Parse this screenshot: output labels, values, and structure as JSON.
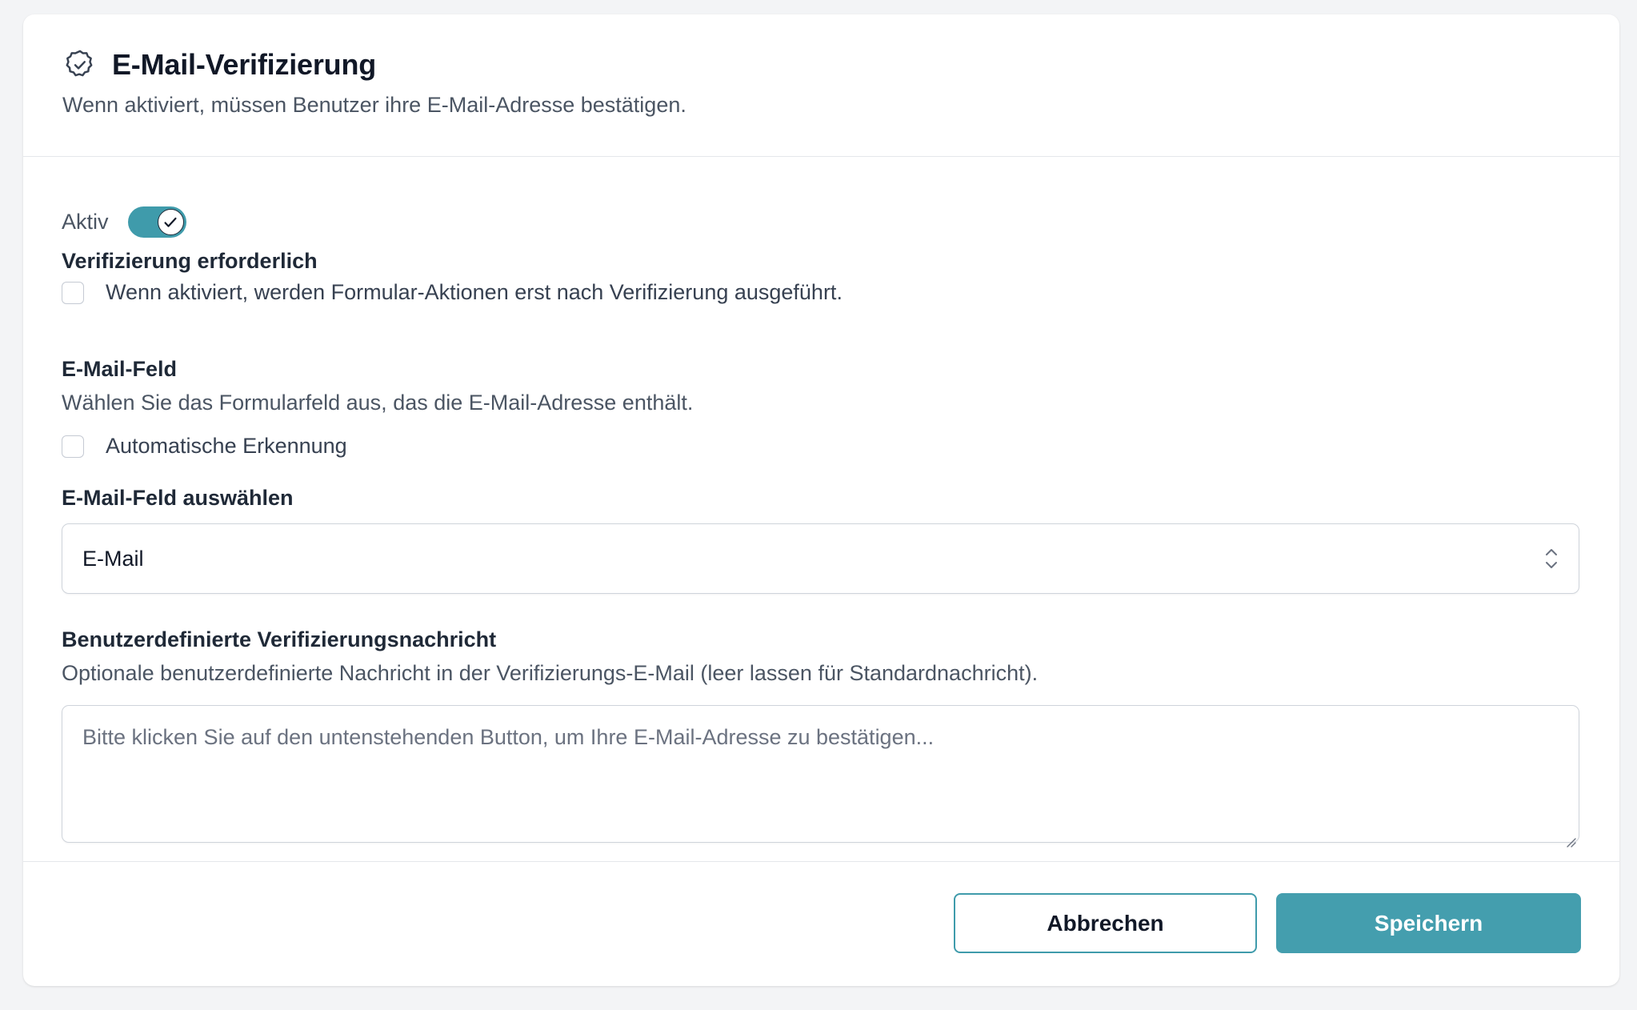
{
  "header": {
    "icon": "badge-check-icon",
    "title": "E-Mail-Verifizierung",
    "description": "Wenn aktiviert, müssen Benutzer ihre E-Mail-Adresse bestätigen."
  },
  "active": {
    "label": "Aktiv",
    "checked": true,
    "accent_color": "#3f9bab"
  },
  "verification_required": {
    "label": "Verifizierung erforderlich",
    "checkbox_text": "Wenn aktiviert, werden Formular-Aktionen erst nach Verifizierung ausgeführt.",
    "checked": false
  },
  "email_field": {
    "label": "E-Mail-Feld",
    "help": "Wählen Sie das Formularfeld aus, das die E-Mail-Adresse enthält.",
    "auto_detect_text": "Automatische Erkennung",
    "auto_detect_checked": false,
    "select_label": "E-Mail-Feld auswählen",
    "select_value": "E-Mail"
  },
  "custom_message": {
    "label": "Benutzerdefinierte Verifizierungsnachricht",
    "help": "Optionale benutzerdefinierte Nachricht in der Verifizierungs-E-Mail (leer lassen für Standardnachricht).",
    "placeholder": "Bitte klicken Sie auf den untenstehenden Button, um Ihre E-Mail-Adresse zu bestätigen...",
    "value": ""
  },
  "footer": {
    "cancel_label": "Abbrechen",
    "save_label": "Speichern",
    "primary_color": "#449eae"
  }
}
